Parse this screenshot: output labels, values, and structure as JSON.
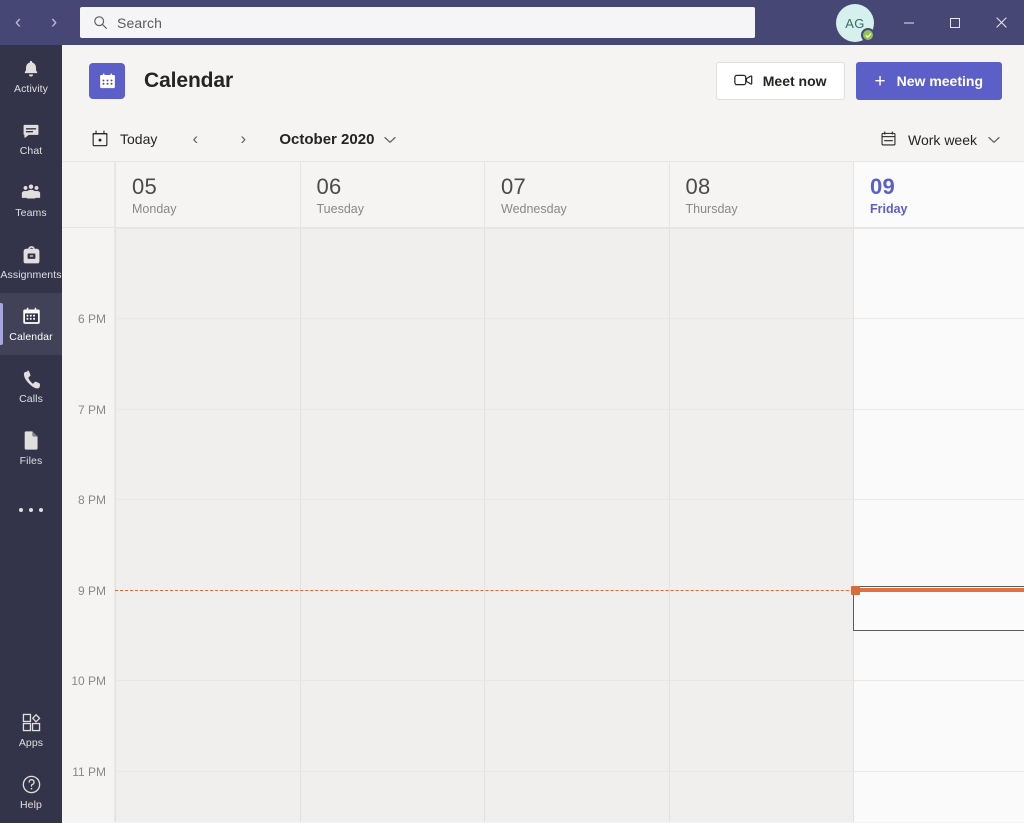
{
  "titlebar": {
    "back_label": "‹",
    "forward_label": "›",
    "search": {
      "placeholder": "Search",
      "value": "",
      "icon": "search-icon"
    },
    "avatar": {
      "initials": "AG",
      "presence": "available"
    },
    "window_controls": {
      "minimize": "─",
      "maximize": "□",
      "close": "✕"
    }
  },
  "rail": {
    "items": [
      {
        "label": "Activity",
        "icon": "bell-icon",
        "active": false
      },
      {
        "label": "Chat",
        "icon": "chat-icon",
        "active": false
      },
      {
        "label": "Teams",
        "icon": "teams-icon",
        "active": false
      },
      {
        "label": "Assignments",
        "icon": "backpack-icon",
        "active": false
      },
      {
        "label": "Calendar",
        "icon": "calendar-icon",
        "active": true
      },
      {
        "label": "Calls",
        "icon": "phone-icon",
        "active": false
      },
      {
        "label": "Files",
        "icon": "files-icon",
        "active": false
      }
    ],
    "more_label": "•••",
    "bottom_items": [
      {
        "label": "Apps",
        "icon": "apps-icon"
      },
      {
        "label": "Help",
        "icon": "help-icon"
      }
    ]
  },
  "header": {
    "app_icon": "calendar-icon",
    "title": "Calendar",
    "meet_now_label": "Meet now",
    "meet_now_icon": "video-camera-icon",
    "new_meeting_label": "New meeting",
    "new_meeting_plus": "+"
  },
  "toolbar": {
    "today_label": "Today",
    "today_icon": "today-calendar-icon",
    "prev_label": "‹",
    "next_label": "›",
    "period_label": "October 2020",
    "period_chevron": "⌄",
    "view_label": "Work week",
    "view_icon": "week-calendar-icon",
    "view_chevron": "⌄"
  },
  "calendar": {
    "days": [
      {
        "num": "05",
        "name": "Monday",
        "today": false
      },
      {
        "num": "06",
        "name": "Tuesday",
        "today": false
      },
      {
        "num": "07",
        "name": "Wednesday",
        "today": false
      },
      {
        "num": "08",
        "name": "Thursday",
        "today": false
      },
      {
        "num": "09",
        "name": "Friday",
        "today": true
      }
    ],
    "time_labels": [
      "6 PM",
      "7 PM",
      "8 PM",
      "9 PM",
      "10 PM",
      "11 PM"
    ],
    "now_indicator_time": "9 PM",
    "colors": {
      "accent": "#5b5fc7",
      "titlebar": "#464775",
      "rail": "#33344a",
      "now_line": "#d96b3c",
      "today_text": "#5b5fc7"
    }
  }
}
